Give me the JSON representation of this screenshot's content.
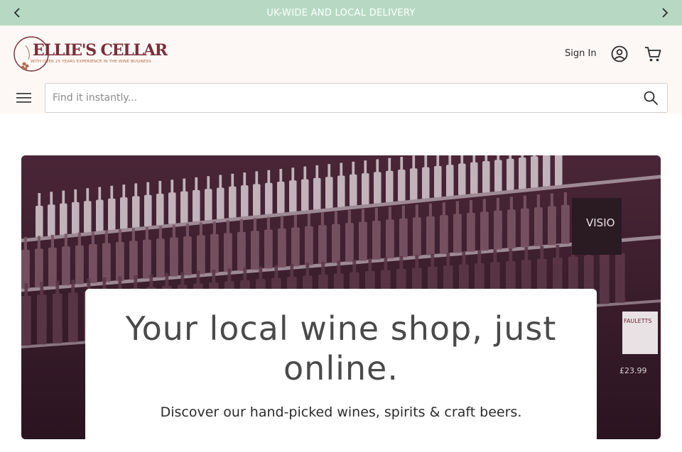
{
  "announcement": {
    "message": "UK-WIDE AND LOCAL DELIVERY",
    "prev_icon": "chevron-left-icon",
    "next_icon": "chevron-right-icon"
  },
  "brand": {
    "name": "ELLIE'S CELLAR",
    "tagline": "WITH OVER 25 YEARS EXPERIENCE IN THE WINE BUSINESS",
    "color": "#7a2e3a"
  },
  "header": {
    "sign_in": "Sign In",
    "account_icon": "user-circle-icon",
    "cart_icon": "shopping-cart-icon",
    "menu_icon": "hamburger-menu-icon"
  },
  "search": {
    "placeholder": "Find it instantly...",
    "value": "",
    "icon": "search-icon"
  },
  "hero": {
    "headline": "Your local wine shop, just online.",
    "subheading": "Discover our hand-picked wines, spirits & craft beers.",
    "shelf_sign": "VISIO",
    "price_tag": "£23.99",
    "label_brand": "FAULETTS"
  },
  "colors": {
    "announcement_bg": "#b7d9c3",
    "header_bg": "#fdf8f5",
    "hero_tint": "#3a1c2a"
  }
}
